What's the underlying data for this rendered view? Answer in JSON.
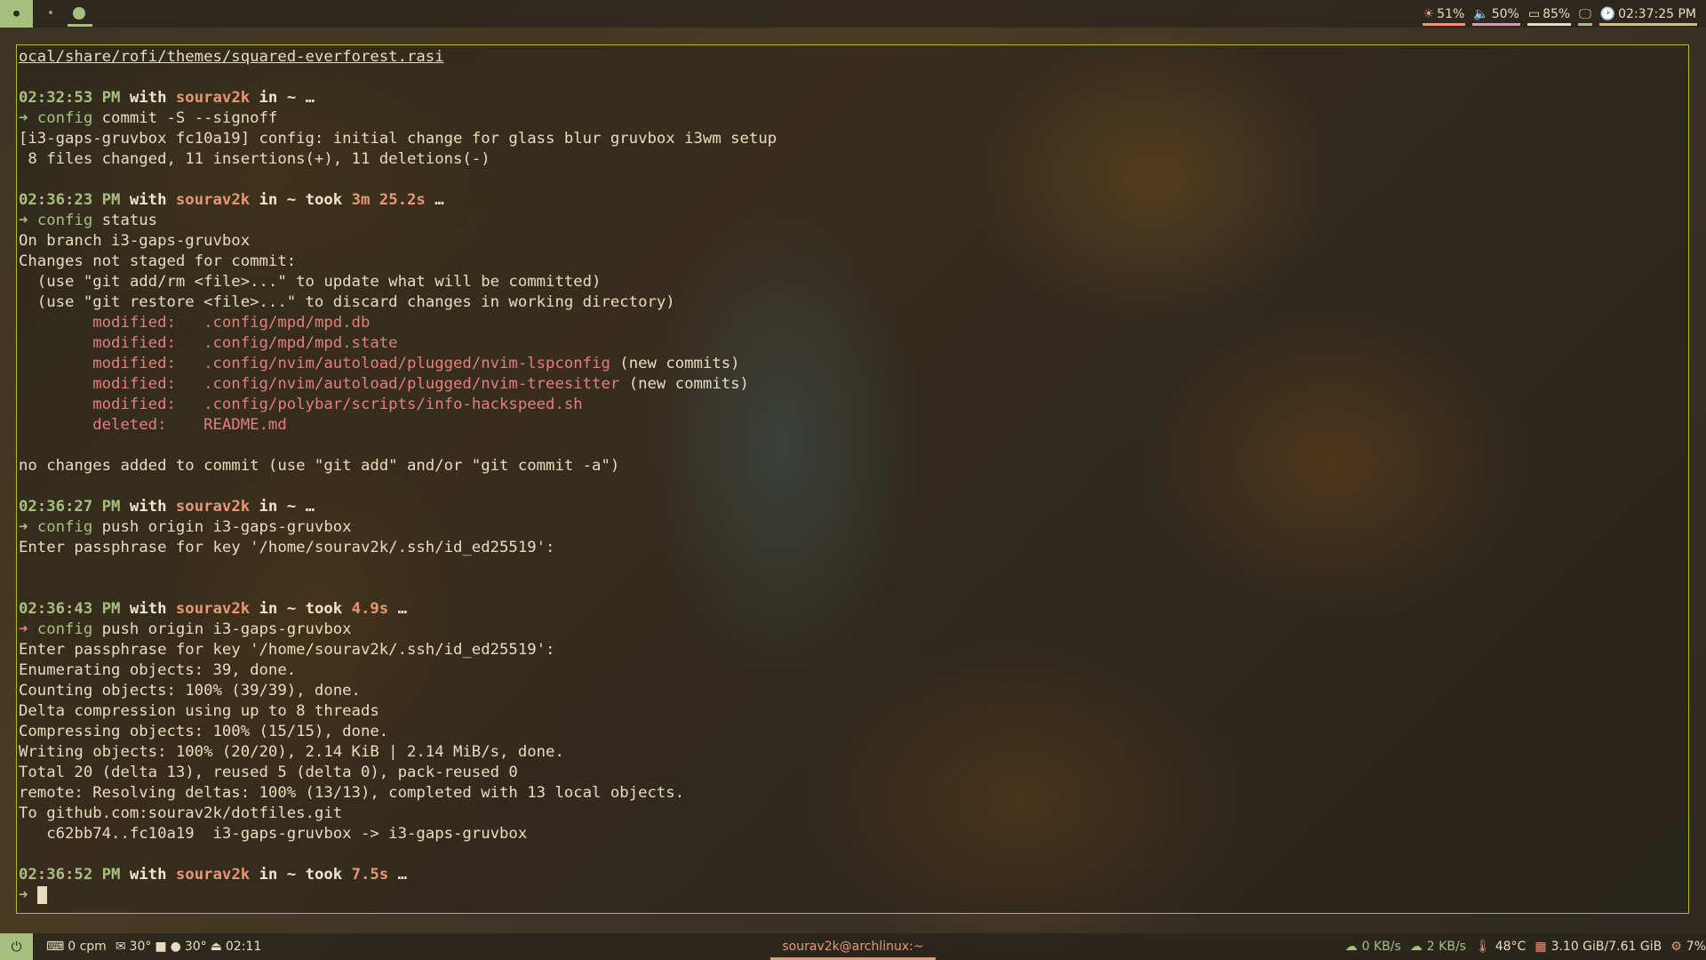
{
  "topbar": {
    "launcher_icon": "⏺",
    "modules": [
      {
        "icon": "☀",
        "name": "brightness-icon",
        "value": "51%",
        "color": "#e69875"
      },
      {
        "icon": "🔈",
        "name": "volume-icon",
        "value": "50%",
        "color": "#d699b6"
      },
      {
        "icon": "▭",
        "name": "battery-icon",
        "value": "85%",
        "color": "#e8dcc0"
      },
      {
        "icon": "🖵",
        "name": "display-icon",
        "value": "",
        "color": "#a7c080"
      },
      {
        "icon": "🕑",
        "name": "clock-icon",
        "value": "02:37:25 PM",
        "color": "#dbbc7f"
      }
    ]
  },
  "terminal": {
    "rofi_path": "ocal/share/rofi/themes/squared-everforest.rasi",
    "p1_time": "02:32:53 PM",
    "p1_cmd_name": "config",
    "p1_cmd_args": " commit -S --signoff",
    "commit_line": "[i3-gaps-gruvbox fc10a19] config: initial change for glass blur gruvbox i3wm setup",
    "commit_stats": " 8 files changed, 11 insertions(+), 11 deletions(-)",
    "p2_time": "02:36:23 PM",
    "p2_took": "3m 25.2s",
    "p2_cmd_name": "config",
    "p2_cmd_args": " status",
    "status_lines": [
      "On branch i3-gaps-gruvbox",
      "Changes not staged for commit:",
      "  (use \"git add/rm <file>...\" to update what will be committed)",
      "  (use \"git restore <file>...\" to discard changes in working directory)"
    ],
    "changes": [
      {
        "kind": "modified:",
        "path": ".config/mpd/mpd.db",
        "note": ""
      },
      {
        "kind": "modified:",
        "path": ".config/mpd/mpd.state",
        "note": ""
      },
      {
        "kind": "modified:",
        "path": ".config/nvim/autoload/plugged/nvim-lspconfig",
        "note": " (new commits)"
      },
      {
        "kind": "modified:",
        "path": ".config/nvim/autoload/plugged/nvim-treesitter",
        "note": " (new commits)"
      },
      {
        "kind": "modified:",
        "path": ".config/polybar/scripts/info-hackspeed.sh",
        "note": ""
      },
      {
        "kind": "deleted:",
        "path": "README.md",
        "note": ""
      }
    ],
    "no_changes": "no changes added to commit (use \"git add\" and/or \"git commit -a\")",
    "p3_time": "02:36:27 PM",
    "p3_cmd_name": "config",
    "p3_cmd_args": " push origin i3-gaps-gruvbox",
    "passphrase": "Enter passphrase for key '/home/sourav2k/.ssh/id_ed25519':",
    "p4_time": "02:36:43 PM",
    "p4_took": "4.9s",
    "p4_cmd_name": "config",
    "p4_cmd_args": " push origin i3-gaps-gruvbox",
    "push_lines": [
      "Enumerating objects: 39, done.",
      "Counting objects: 100% (39/39), done.",
      "Delta compression using up to 8 threads",
      "Compressing objects: 100% (15/15), done.",
      "Writing objects: 100% (20/20), 2.14 KiB | 2.14 MiB/s, done.",
      "Total 20 (delta 13), reused 5 (delta 0), pack-reused 0",
      "remote: Resolving deltas: 100% (13/13), completed with 13 local objects.",
      "To github.com:sourav2k/dotfiles.git",
      "   c62bb74..fc10a19  i3-gaps-gruvbox -> i3-gaps-gruvbox"
    ],
    "p5_time": "02:36:52 PM",
    "p5_took": "7.5s",
    "with_word": "with",
    "user": "sourav2k",
    "in_word": "in",
    "tilde": "~",
    "took_word": "took",
    "ellipsis": "…",
    "arrow": "➜"
  },
  "bottombar": {
    "power_icon": "⏻",
    "cpm": "0 cpm",
    "mail_temp": "30°",
    "loc_temp": "30°",
    "time": "02:11",
    "window_title": "sourav2k@archlinux:~",
    "down_speed": "0 KB/s",
    "up_speed": "2 KB/s",
    "cpu_temp": "48°C",
    "memory": "3.10 GiB/7.61 GiB",
    "cpu_load": "7%"
  }
}
